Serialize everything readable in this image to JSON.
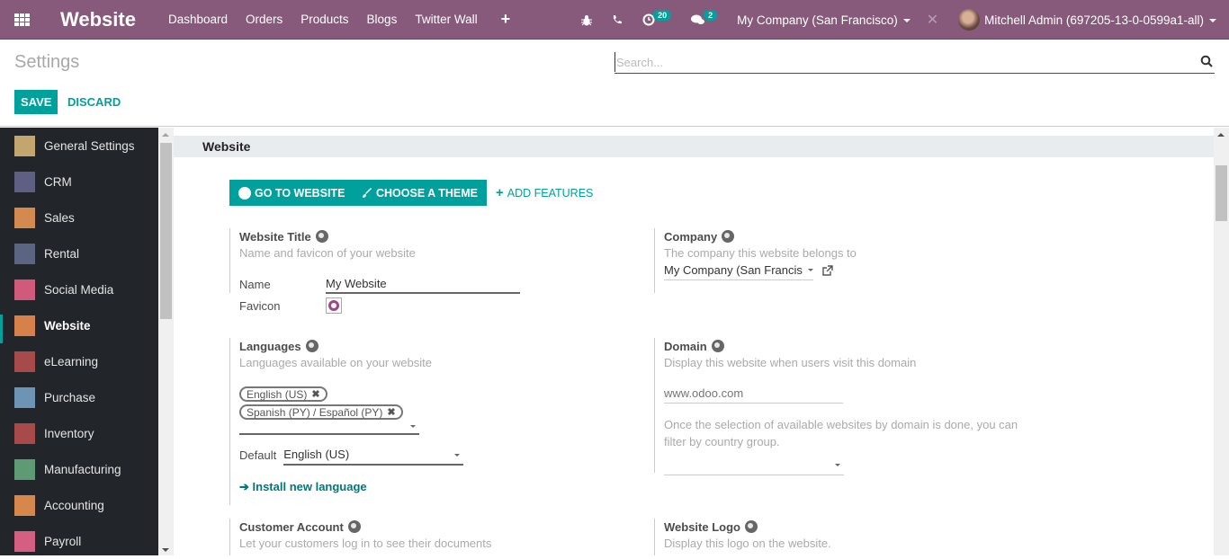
{
  "navbar": {
    "brand": "Website",
    "menu": [
      "Dashboard",
      "Orders",
      "Products",
      "Blogs",
      "Twitter Wall"
    ],
    "activity_count": "20",
    "messages_count": "2",
    "company": "My Company (San Francisco)",
    "user": "Mitchell Admin (697205-13-0-0599a1-all)"
  },
  "control": {
    "title": "Settings",
    "save_label": "SAVE",
    "discard_label": "DISCARD",
    "search_placeholder": "Search..."
  },
  "sidebar": {
    "items": [
      {
        "label": "General Settings",
        "icon": "gear-icon",
        "color": "#c2a66e",
        "active": false
      },
      {
        "label": "CRM",
        "icon": "handshake-icon",
        "color": "#5f5f83",
        "active": false
      },
      {
        "label": "Sales",
        "icon": "chart-icon",
        "color": "#d48a4e",
        "active": false
      },
      {
        "label": "Rental",
        "icon": "rental-icon",
        "color": "#5b6480",
        "active": false
      },
      {
        "label": "Social Media",
        "icon": "thumbs-up-icon",
        "color": "#d15a7c",
        "active": false
      },
      {
        "label": "Website",
        "icon": "globe-icon",
        "color": "#d6814c",
        "active": true
      },
      {
        "label": "eLearning",
        "icon": "elearning-icon",
        "color": "#a64a4a",
        "active": false
      },
      {
        "label": "Purchase",
        "icon": "card-icon",
        "color": "#6d93b5",
        "active": false
      },
      {
        "label": "Inventory",
        "icon": "box-icon",
        "color": "#a84a4a",
        "active": false
      },
      {
        "label": "Manufacturing",
        "icon": "wrench-icon",
        "color": "#5e9a74",
        "active": false
      },
      {
        "label": "Accounting",
        "icon": "invoice-icon",
        "color": "#d6874c",
        "active": false
      },
      {
        "label": "Payroll",
        "icon": "payroll-icon",
        "color": "#d45f82",
        "active": false
      }
    ]
  },
  "main": {
    "section_title": "Website",
    "go_to_website": "GO TO WEBSITE",
    "choose_theme": "CHOOSE A THEME",
    "add_features": "ADD FEATURES",
    "website_title": {
      "title": "Website Title",
      "desc": "Name and favicon of your website",
      "name_label": "Name",
      "name_value": "My Website",
      "favicon_label": "Favicon"
    },
    "company": {
      "title": "Company",
      "desc": "The company this website belongs to",
      "value": "My Company (San Francis"
    },
    "languages": {
      "title": "Languages",
      "desc": "Languages available on your website",
      "tags": [
        "English (US)",
        "Spanish (PY) / Español (PY)"
      ],
      "default_label": "Default",
      "default_value": "English (US)",
      "install_link": "Install new language"
    },
    "domain": {
      "title": "Domain",
      "desc": "Display this website when users visit this domain",
      "placeholder": "www.odoo.com",
      "note": "Once the selection of available websites by domain is done, you can filter by country group."
    },
    "customer_account": {
      "title": "Customer Account",
      "desc": "Let your customers log in to see their documents"
    },
    "website_logo": {
      "title": "Website Logo",
      "desc": "Display this logo on the website."
    }
  }
}
